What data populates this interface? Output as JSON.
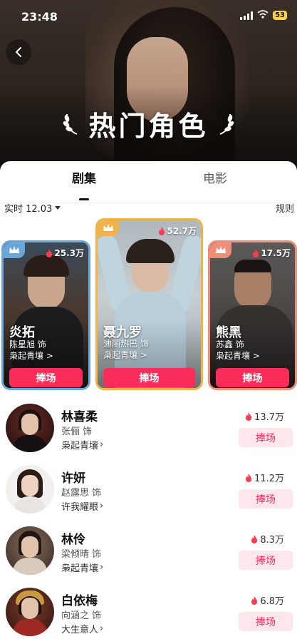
{
  "status": {
    "time": "23:48",
    "battery": "53"
  },
  "hero": {
    "title": "热门角色"
  },
  "tabs": [
    {
      "label": "剧集"
    },
    {
      "label": "电影"
    }
  ],
  "filter": {
    "label": "实时 12.03"
  },
  "rules": "规则",
  "colors": {
    "accent": "#fa2d5a",
    "accent_light": "#fde6ec",
    "gold": "#f0b34a",
    "blue": "#6aa6d8",
    "coral": "#ee8d78"
  },
  "top3": [
    {
      "rank": 2,
      "role": "炎拓",
      "actor": "陈星旭 饰",
      "drama": "枭起青壤 >",
      "heat": "25.3万",
      "button": "捧场"
    },
    {
      "rank": 1,
      "role": "聂九罗",
      "actor": "迪丽热巴 饰",
      "drama": "枭起青壤 >",
      "heat": "52.7万",
      "button": "捧场"
    },
    {
      "rank": 3,
      "role": "熊黑",
      "actor": "苏鑫 饰",
      "drama": "枭起青壤 >",
      "heat": "17.5万",
      "button": "捧场"
    }
  ],
  "list": [
    {
      "role": "林喜柔",
      "actor": "张俪 饰",
      "drama": "枭起青壤",
      "heat": "13.7万",
      "button": "捧场"
    },
    {
      "role": "许妍",
      "actor": "赵露思 饰",
      "drama": "许我耀眼",
      "heat": "11.2万",
      "button": "捧场"
    },
    {
      "role": "林伶",
      "actor": "梁倾晴 饰",
      "drama": "枭起青壤",
      "heat": "8.3万",
      "button": "捧场"
    },
    {
      "role": "白依梅",
      "actor": "向涵之 饰",
      "drama": "大生意人",
      "heat": "6.8万",
      "button": "捧场"
    }
  ]
}
